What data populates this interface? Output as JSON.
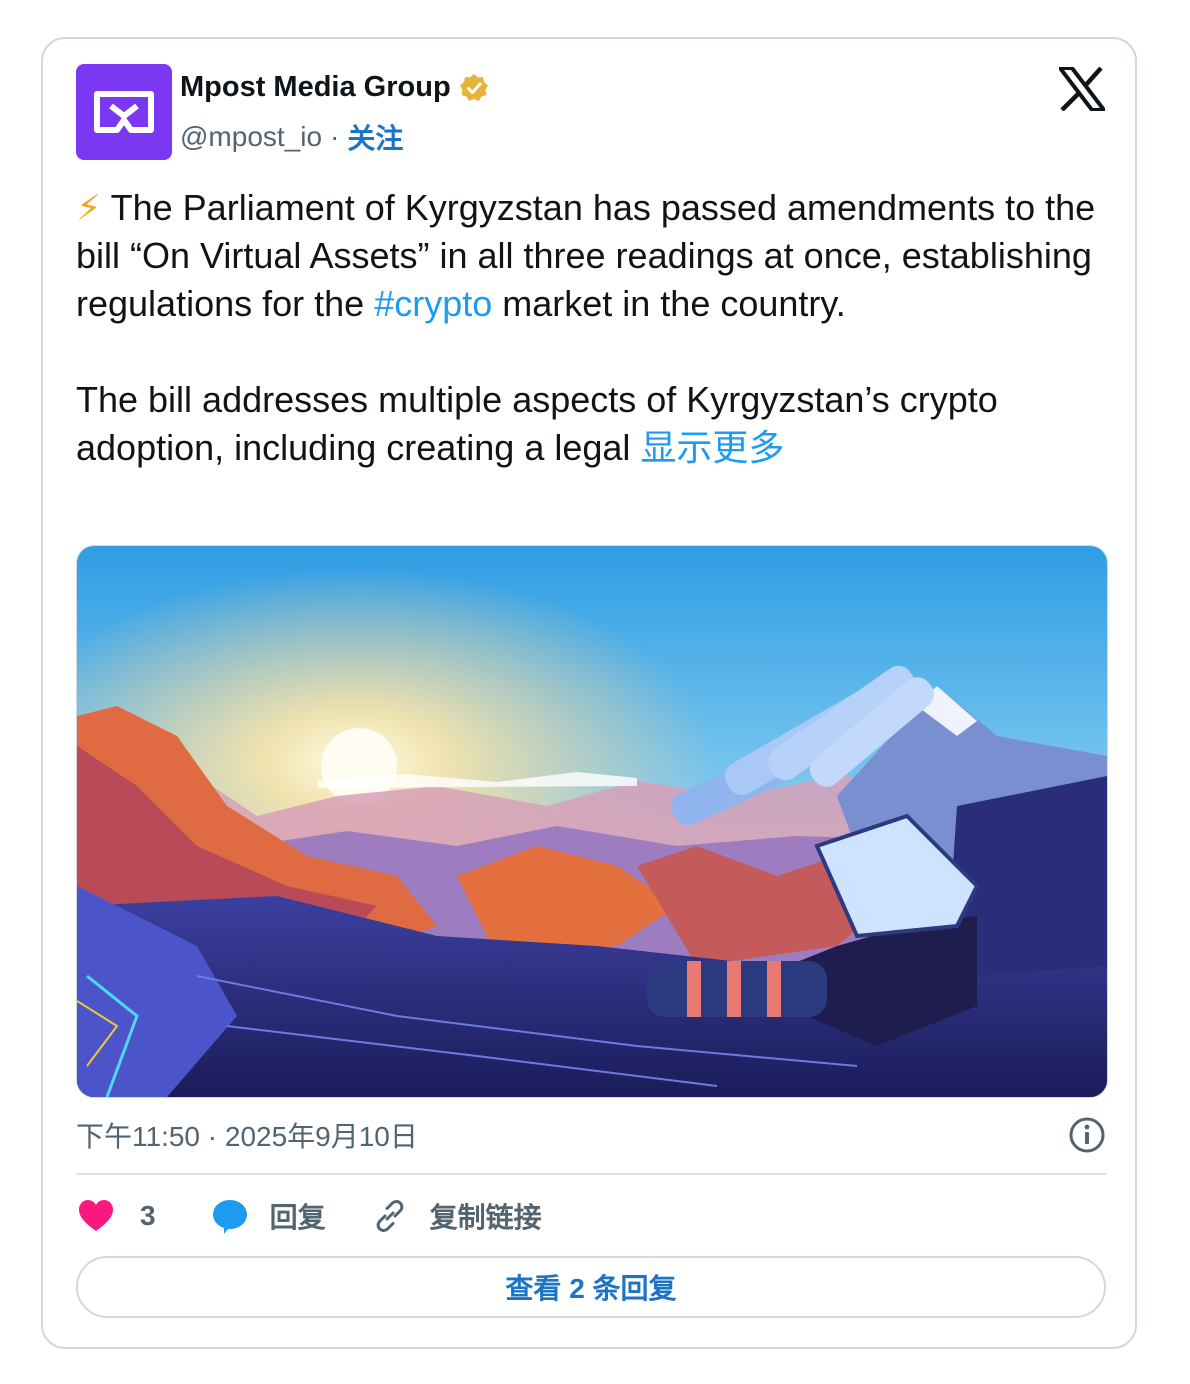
{
  "author": {
    "name": "Mpost Media Group",
    "handle": "@mpost_io",
    "separator": "·",
    "follow_label": "关注",
    "verified": true,
    "avatar_color": "#7b38f2",
    "badge_color": "#e8b33a"
  },
  "platform_icon": "x-logo-icon",
  "tweet": {
    "emoji": "⚡",
    "para1_part1": " The Parliament of Kyrgyzstan has passed amendments to the bill “On Virtual Assets” in all three readings at once, establishing regulations for the ",
    "hashtag": "#crypto",
    "para1_part2": " market in the country.",
    "para2": "The bill addresses multiple aspects of Kyrgyzstan’s crypto adoption, including creating a legal ",
    "show_more_label": "显示更多",
    "link_color": "#1d9bf0"
  },
  "media": {
    "icon": "robot-hand-mountain-sunrise-illustration"
  },
  "meta": {
    "timestamp": "下午11:50 · 2025年9月10日",
    "info_icon": "info-icon"
  },
  "actions": {
    "like_count": "3",
    "reply_label": "回复",
    "copy_link_label": "复制链接",
    "like_color": "#f91880",
    "reply_color": "#1d9bf0"
  },
  "view_replies_label": "查看 2 条回复"
}
